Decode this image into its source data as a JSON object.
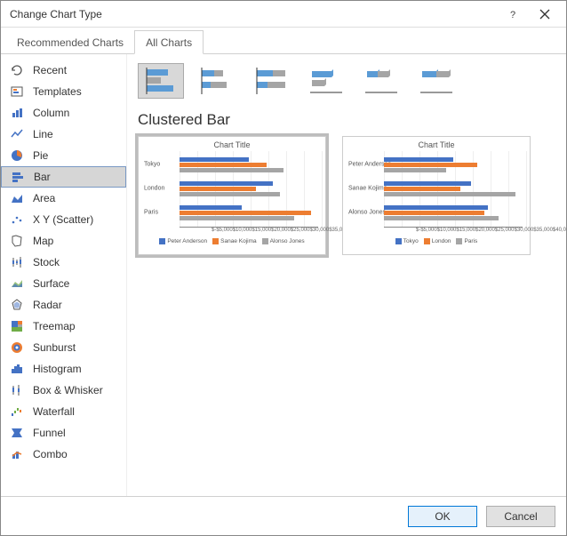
{
  "window": {
    "title": "Change Chart Type"
  },
  "tabs": {
    "recommended": "Recommended Charts",
    "all": "All Charts"
  },
  "sidebar": {
    "items": [
      {
        "label": "Recent"
      },
      {
        "label": "Templates"
      },
      {
        "label": "Column"
      },
      {
        "label": "Line"
      },
      {
        "label": "Pie"
      },
      {
        "label": "Bar"
      },
      {
        "label": "Area"
      },
      {
        "label": "X Y (Scatter)"
      },
      {
        "label": "Map"
      },
      {
        "label": "Stock"
      },
      {
        "label": "Surface"
      },
      {
        "label": "Radar"
      },
      {
        "label": "Treemap"
      },
      {
        "label": "Sunburst"
      },
      {
        "label": "Histogram"
      },
      {
        "label": "Box & Whisker"
      },
      {
        "label": "Waterfall"
      },
      {
        "label": "Funnel"
      },
      {
        "label": "Combo"
      }
    ],
    "selected_index": 5
  },
  "subtypes": {
    "selected_index": 0,
    "names": [
      "clustered-bar",
      "stacked-bar",
      "100-stacked-bar",
      "3d-clustered-bar",
      "3d-stacked-bar",
      "3d-100-stacked-bar"
    ]
  },
  "subtype_title": "Clustered Bar",
  "previews": {
    "selected_index": 0,
    "items": [
      {
        "title": "Chart Title",
        "categories": [
          "Tokyo",
          "London",
          "Paris"
        ],
        "legend": [
          "Peter Anderson",
          "Sanae Kojima",
          "Alonso Jones"
        ]
      },
      {
        "title": "Chart Title",
        "categories": [
          "Peter Anderson",
          "Sanae Kojima",
          "Alonso Jones"
        ],
        "legend": [
          "Tokyo",
          "London",
          "Paris"
        ]
      }
    ]
  },
  "ticks": [
    "$-",
    "$5,000",
    "$10,000",
    "$15,000",
    "$20,000",
    "$25,000",
    "$30,000",
    "$35,000",
    "$40,000"
  ],
  "colors": {
    "s1": "#4472C4",
    "s2": "#ED7D31",
    "s3": "#A5A5A5"
  },
  "buttons": {
    "ok": "OK",
    "cancel": "Cancel"
  },
  "chart_data": [
    {
      "type": "bar",
      "title": "Chart Title",
      "orientation": "horizontal",
      "categories": [
        "Tokyo",
        "London",
        "Paris"
      ],
      "series": [
        {
          "name": "Peter Anderson",
          "values": [
            20000,
            27000,
            18000
          ]
        },
        {
          "name": "Sanae Kojima",
          "values": [
            25000,
            22000,
            38000
          ]
        },
        {
          "name": "Alonso Jones",
          "values": [
            30000,
            29000,
            33000
          ]
        }
      ],
      "xlabel": "",
      "ylabel": "",
      "xlim": [
        0,
        40000
      ],
      "x_prefix": "$"
    },
    {
      "type": "bar",
      "title": "Chart Title",
      "orientation": "horizontal",
      "categories": [
        "Peter Anderson",
        "Sanae Kojima",
        "Alonso Jones"
      ],
      "series": [
        {
          "name": "Tokyo",
          "values": [
            20000,
            25000,
            30000
          ]
        },
        {
          "name": "London",
          "values": [
            27000,
            22000,
            29000
          ]
        },
        {
          "name": "Paris",
          "values": [
            18000,
            38000,
            33000
          ]
        }
      ],
      "xlabel": "",
      "ylabel": "",
      "xlim": [
        0,
        40000
      ],
      "x_prefix": "$"
    }
  ]
}
